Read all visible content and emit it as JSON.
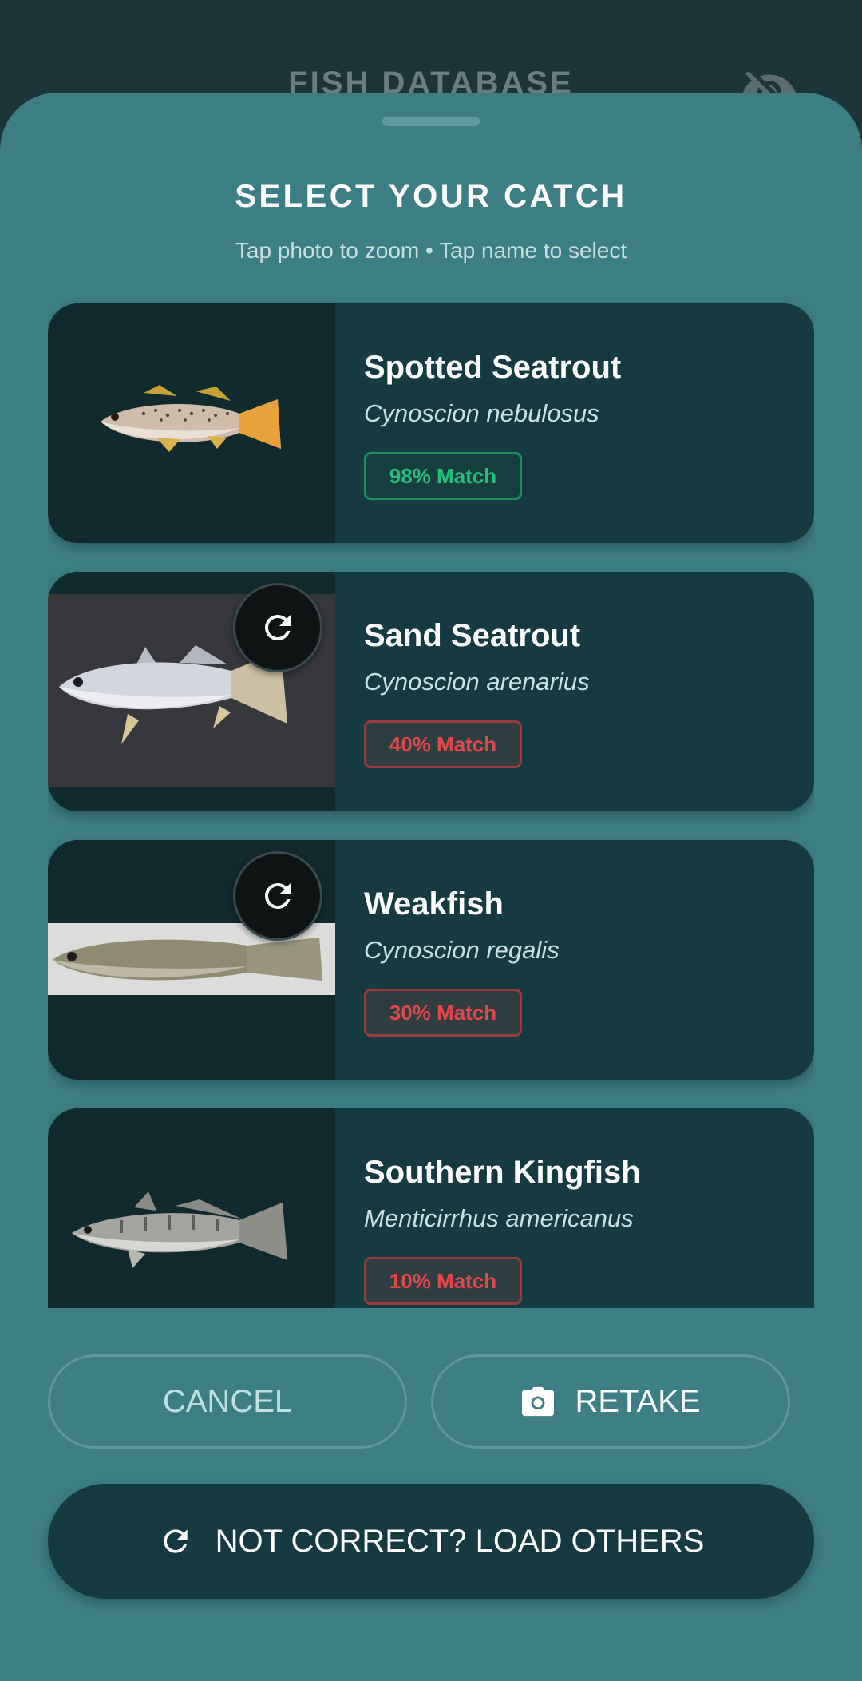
{
  "header": {
    "title": "FISH DATABASE",
    "visibility_icon": "eye-off-icon"
  },
  "sheet": {
    "title": "SELECT YOUR CATCH",
    "subtitle": "Tap photo to zoom • Tap name to select"
  },
  "catches": [
    {
      "common_name": "Spotted Seatrout",
      "scientific_name": "Cynoscion nebulosus",
      "match_label": "98% Match",
      "match_percent": 98,
      "match_status": "high",
      "has_refresh": false
    },
    {
      "common_name": "Sand Seatrout",
      "scientific_name": "Cynoscion arenarius",
      "match_label": "40% Match",
      "match_percent": 40,
      "match_status": "low",
      "has_refresh": true
    },
    {
      "common_name": "Weakfish",
      "scientific_name": "Cynoscion regalis",
      "match_label": "30% Match",
      "match_percent": 30,
      "match_status": "low",
      "has_refresh": true
    },
    {
      "common_name": "Southern Kingfish",
      "scientific_name": "Menticirrhus americanus",
      "match_label": "10% Match",
      "match_percent": 10,
      "match_status": "low",
      "has_refresh": false
    }
  ],
  "actions": {
    "cancel_label": "CANCEL",
    "retake_label": "RETAKE",
    "retake_icon": "camera-icon",
    "load_others_label": "NOT CORRECT? LOAD OTHERS",
    "load_others_icon": "refresh-icon"
  },
  "colors": {
    "sheet_bg": "#3d7e85",
    "card_bg": "#153a41",
    "match_high": "#24c17c",
    "match_low": "#e2484a"
  }
}
